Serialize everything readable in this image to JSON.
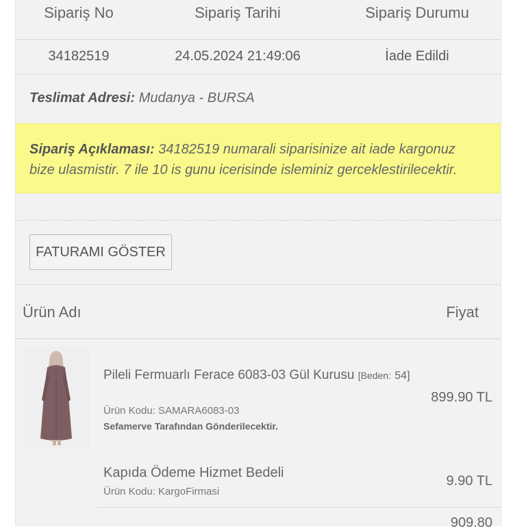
{
  "order": {
    "headers": {
      "no": "Sipariş No",
      "date": "Sipariş Tarihi",
      "status": "Sipariş Durumu"
    },
    "values": {
      "no": "34182519",
      "date": "24.05.2024 21:49:06",
      "status": "İade Edildi"
    },
    "address_label": "Teslimat Adresi:",
    "address_value": "Mudanya - BURSA",
    "note_label": "Sipariş Açıklaması:",
    "note_text": "34182519 numarali siparisinize ait iade kargonuz bize ulasmistir. 7 ile 10 is gunu icerisinde isleminiz gerceklestirilecektir.",
    "invoice_button": "FATURAMI GÖSTER"
  },
  "items_table": {
    "col_name": "Ürün Adı",
    "col_price": "Fiyat",
    "items": [
      {
        "name": "Pileli Fermuarlı Ferace 6083-03 Gül Kurusu",
        "size": "[Beden:",
        "size_value": "54]",
        "code": "Ürün Kodu: SAMARA6083-03",
        "seller": "Sefamerve Tarafından Gönderilecektir.",
        "price": "899.90 TL"
      },
      {
        "name": "Kapıda Ödeme Hizmet Bedeli",
        "code": "Ürün Kodu: KargoFirmasi",
        "price": "9.90 TL"
      }
    ],
    "total_partial": "909.80"
  },
  "colors": {
    "note_bg": "#fafa8c",
    "panel_bg": "#f2f2f2",
    "dress": "#7d5f63"
  }
}
